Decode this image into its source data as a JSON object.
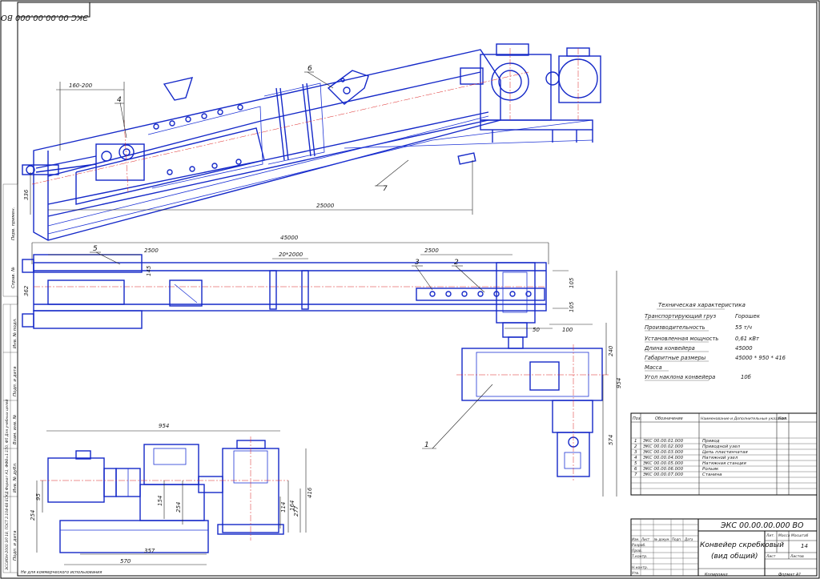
{
  "stamp_code_mirrored": "ЭКС 00.00.00.000 ВО",
  "title_block": {
    "code": "ЭКС 00.00.00.000 ВО",
    "name_line1": "Конвейер скребковый",
    "name_line2": "(вид общий)",
    "sheet": "14",
    "roles": [
      "Изм.",
      "Лист",
      "№ докум.",
      "Подп.",
      "Дата",
      "Разраб.",
      "Пров.",
      "Т.контр.",
      "Н.контр.",
      "Утв."
    ],
    "columns": [
      "Лит.",
      "Масса",
      "Масштаб"
    ],
    "sheet_label": "Лист",
    "sheets_label": "Листов",
    "copied": "Копировал",
    "format": "Формат   А1"
  },
  "characteristics": {
    "heading": "Техническая характеристика",
    "rows": [
      {
        "label": "Транспортирующий груз",
        "value": "Горошек"
      },
      {
        "label": "Производительность",
        "value": "55 т/ч"
      },
      {
        "label": "Установленная мощность",
        "value": "0,61 кВт"
      },
      {
        "label": "Длина конвейера",
        "value": "45000"
      },
      {
        "label": "Габаритные размеры",
        "value": "45000 * 950 * 416"
      },
      {
        "label": "Масса",
        "value": ""
      },
      {
        "label": "Угол наклона конвейера",
        "value": "10б"
      }
    ]
  },
  "parts_table": {
    "headers": [
      "Поз.",
      "Обозначение",
      "Наименование и Дополнительные указания",
      "Кол."
    ],
    "rows": [
      {
        "pos": "1",
        "code": "ЭКС 00.00.01.000",
        "name": "Привод"
      },
      {
        "pos": "2",
        "code": "ЭКС 00.00.02.000",
        "name": "Приводной узел"
      },
      {
        "pos": "3",
        "code": "ЭКС 00.00.03.000",
        "name": "Цепь пластинчатая"
      },
      {
        "pos": "4",
        "code": "ЭКС 00.00.04.000",
        "name": "Натяжной узел"
      },
      {
        "pos": "5",
        "code": "ЭКС 00.00.05.000",
        "name": "Натяжная станция"
      },
      {
        "pos": "6",
        "code": "ЭКС 00.00.06.000",
        "name": "Рольик"
      },
      {
        "pos": "7",
        "code": "ЭКС 00.00.07.000",
        "name": "Станина"
      }
    ]
  },
  "callouts": [
    "1",
    "2",
    "3",
    "4",
    "5",
    "6",
    "7"
  ],
  "dimensions": {
    "top_160_200": "160-200",
    "top_25000": "25000",
    "top_336": "336",
    "plan_45000": "45000",
    "plan_2500_left": "2500",
    "plan_2500_right": "2500",
    "plan_20_2000": "20*2000",
    "plan_145": "145",
    "plan_362": "362",
    "plan_105a": "105",
    "plan_105b": "105",
    "drive_50": "50",
    "drive_100": "100",
    "drive_240": "240",
    "drive_954": "954",
    "drive_574": "574",
    "side_954": "954",
    "side_357": "357",
    "side_570": "570",
    "side_254a": "254",
    "side_254b": "254",
    "side_95": "95",
    "side_154": "154",
    "side_277": "277",
    "side_416": "416",
    "side_164": "164",
    "side_114": "114"
  },
  "left_margin": {
    "inv_orig": "Инв. № подл.",
    "sign_date1": "Подп. и дата",
    "inv_dup": "Взам. инв. №",
    "inv_dubl": "Инв. № дубл.",
    "sign_date2": "Подп. и дата",
    "perv_prim": "Перв. примен.",
    "sprav": "Справ. №",
    "footnote": "ЭССИОН-2000 ЭЛ 18, ГОСТ 2.104-68 ЕСКД Формат А1, ФФВ=1:150, Ф5 Для учебных целей",
    "bottom_note": "Не для коммерческого использования"
  }
}
